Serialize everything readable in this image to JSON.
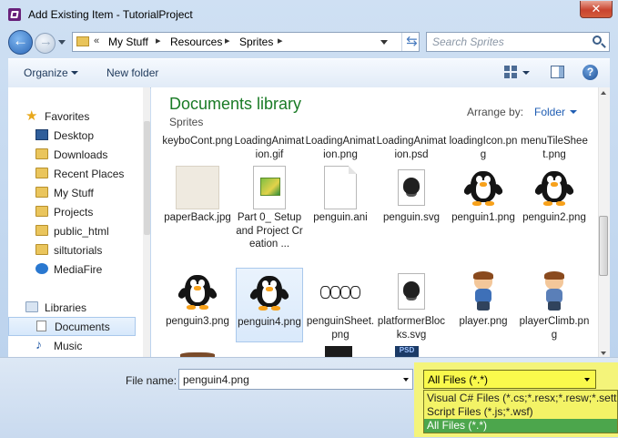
{
  "window": {
    "title": "Add Existing Item - TutorialProject",
    "close_label": "✕"
  },
  "address": {
    "overflow_label": "«",
    "crumbs": [
      "My Stuff",
      "Resources",
      "Sprites"
    ],
    "separator": "▸"
  },
  "search": {
    "placeholder": "Search Sprites"
  },
  "toolbar": {
    "organize_label": "Organize",
    "new_folder_label": "New folder",
    "help_label": "?"
  },
  "nav": {
    "favorites": {
      "label": "Favorites",
      "items": [
        "Desktop",
        "Downloads",
        "Recent Places",
        "My Stuff",
        "Projects",
        "public_html",
        "siltutorials",
        "MediaFire"
      ]
    },
    "libraries": {
      "label": "Libraries",
      "items": [
        "Documents",
        "Music"
      ]
    }
  },
  "content": {
    "title": "Documents library",
    "subtitle": "Sprites",
    "arrange_label": "Arrange by:",
    "arrange_value": "Folder",
    "files": [
      {
        "name": "keyboCont.png",
        "kind": "partial"
      },
      {
        "name": "LoadingAnimation.gif",
        "kind": "partial"
      },
      {
        "name": "LoadingAnimation.png",
        "kind": "partial"
      },
      {
        "name": "LoadingAnimation.psd",
        "kind": "partial"
      },
      {
        "name": "loadingIcon.png",
        "kind": "partial"
      },
      {
        "name": "menuTileSheet.png",
        "kind": "partial"
      },
      {
        "name": "paperBack.jpg",
        "kind": "paper"
      },
      {
        "name": "Part 0_ Setup and Project Creation ...",
        "kind": "doc-image"
      },
      {
        "name": "penguin.ani",
        "kind": "doc"
      },
      {
        "name": "penguin.svg",
        "kind": "ink"
      },
      {
        "name": "penguin1.png",
        "kind": "penguin"
      },
      {
        "name": "penguin2.png",
        "kind": "penguin"
      },
      {
        "name": "penguin3.png",
        "kind": "penguin"
      },
      {
        "name": "penguin4.png",
        "kind": "penguin",
        "selected": true
      },
      {
        "name": "penguinSheet.png",
        "kind": "sheet"
      },
      {
        "name": "platformerBlocks.svg",
        "kind": "ink"
      },
      {
        "name": "player.png",
        "kind": "player"
      },
      {
        "name": "playerClimb.png",
        "kind": "player"
      }
    ]
  },
  "footer": {
    "filename_label": "File name:",
    "filename_value": "penguin4.png",
    "filter_value": "All Files (*.*)",
    "filter_options": [
      "Visual C# Files (*.cs;*.resx;*.resw;*.settings",
      "Script Files (*.js;*.wsf)",
      "All Files (*.*)"
    ]
  },
  "colors": {
    "library_title": "#1a7b26",
    "link": "#1f5db3",
    "highlight": "#f4f47a",
    "selected_option": "#4ca64c"
  }
}
